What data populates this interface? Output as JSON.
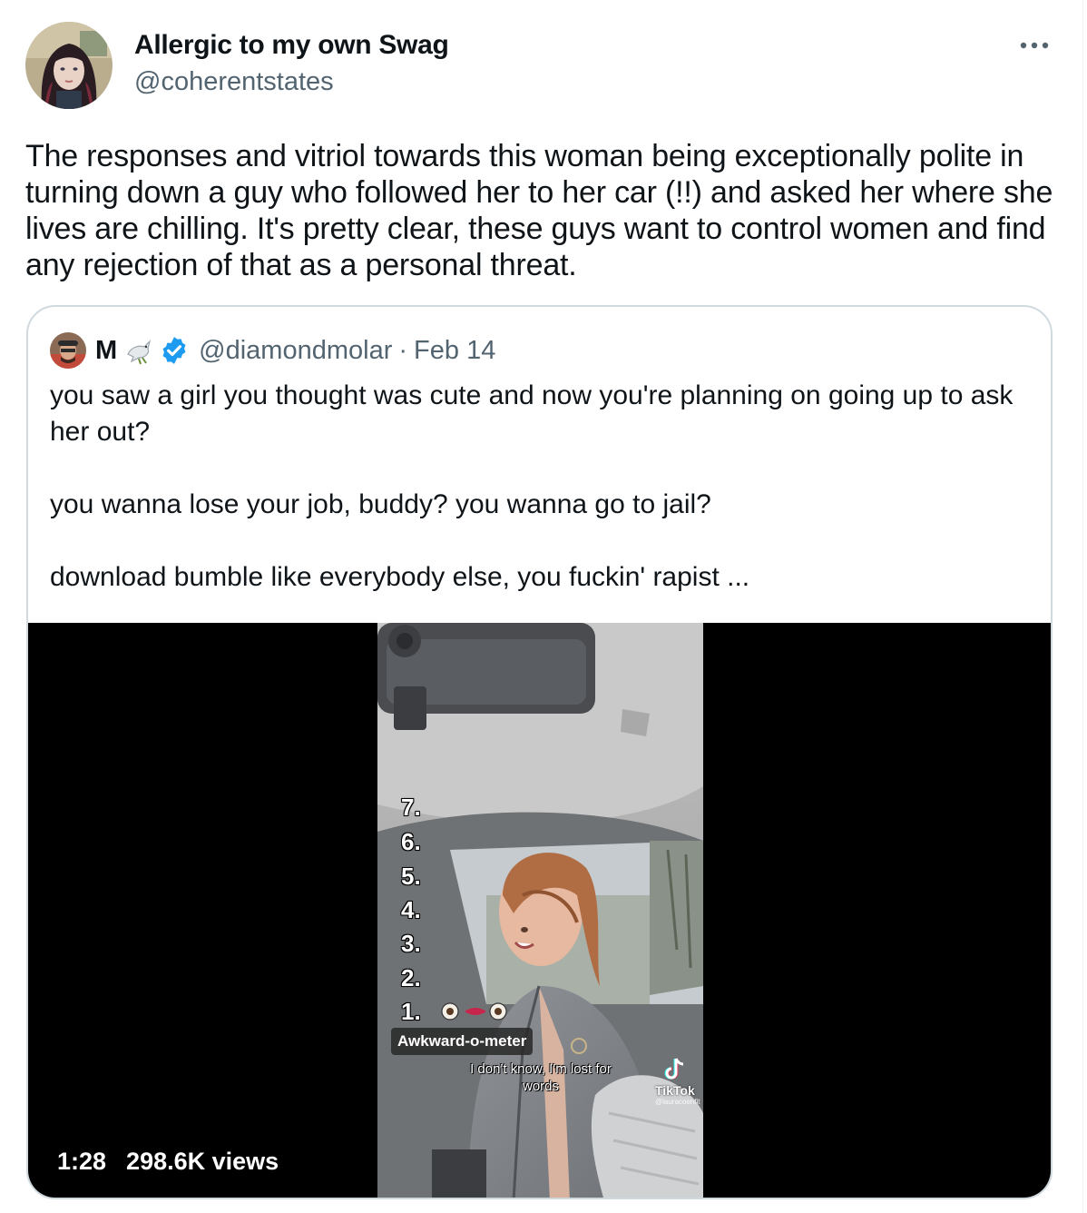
{
  "tweet": {
    "display_name": "Allergic to my own Swag",
    "handle": "@coherentstates",
    "more_icon": "ellipsis-icon",
    "text": "The responses and vitriol towards this woman being exceptionally polite in turning down a guy who followed her to her car (!!) and asked her where she lives are chilling. It's pretty clear, these guys want to control women and find any rejection of that as a personal threat."
  },
  "quote": {
    "display_name": "M",
    "name_emoji": "dove-icon",
    "verified_icon": "verified-badge-icon",
    "handle": "@diamondmolar",
    "separator": "·",
    "date": "Feb 14",
    "paragraphs": [
      "you saw a girl you thought was cute and now you're planning on going up to ask her out?",
      "you wanna lose your job, buddy? you wanna go to jail?",
      "download bumble like everybody else, you fuckin' rapist ..."
    ],
    "video": {
      "duration": "1:28",
      "views": "298.6K views",
      "overlay_numbers": [
        "7.",
        "6.",
        "5.",
        "4.",
        "3.",
        "2.",
        "1."
      ],
      "meter_label": "Awkward-o-meter",
      "caption": "I don't know, I'm lost for words",
      "watermark": "TikTok",
      "watermark_user": "@lauracoenfit"
    }
  },
  "colors": {
    "text_primary": "#0f1419",
    "text_secondary": "#536471",
    "border": "#cfd9de",
    "verified_blue": "#1d9bf0"
  }
}
